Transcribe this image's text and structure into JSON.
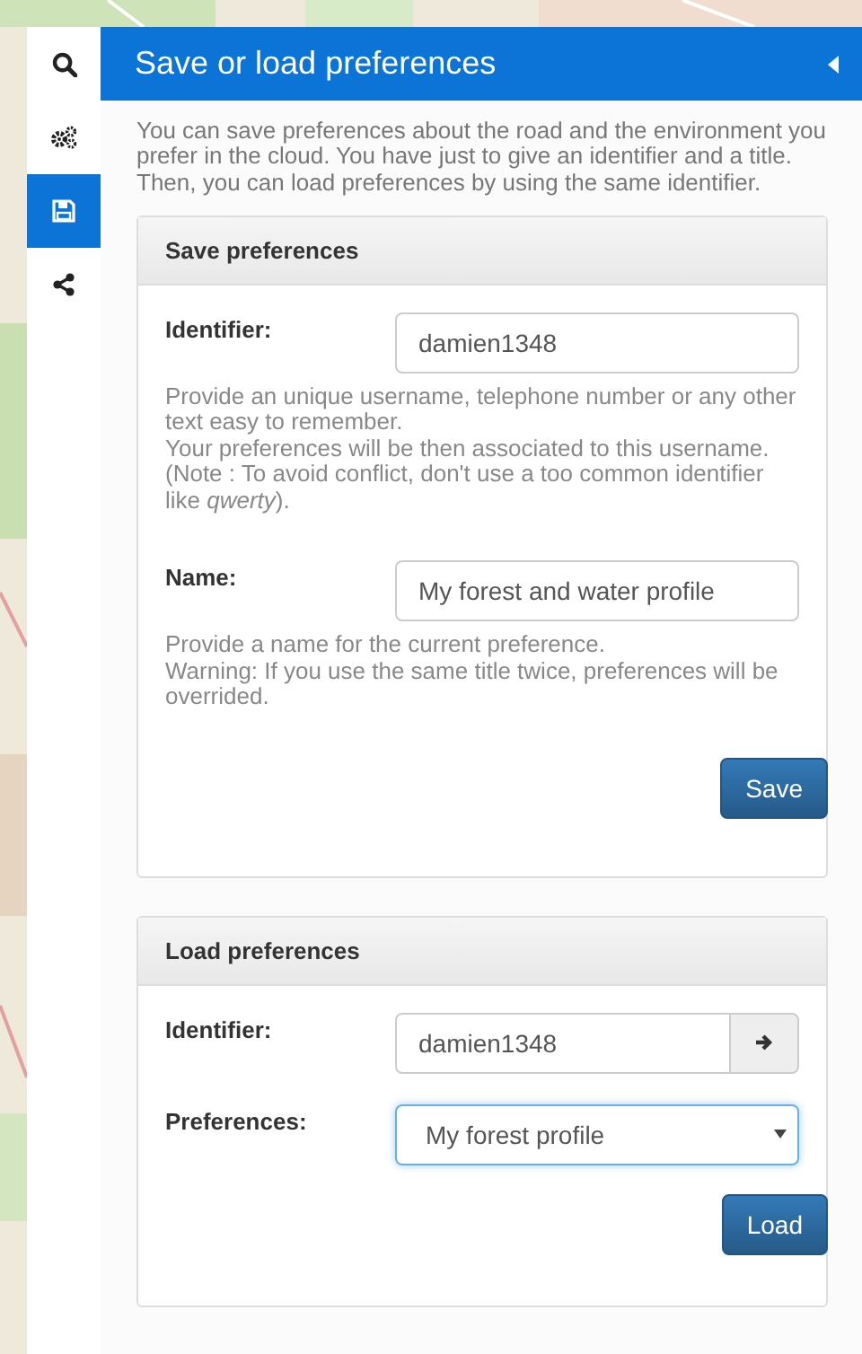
{
  "sidebar": {
    "items": [
      {
        "kind": "search",
        "selected": false
      },
      {
        "kind": "gears",
        "selected": false
      },
      {
        "kind": "save",
        "selected": true
      },
      {
        "kind": "share",
        "selected": false
      }
    ]
  },
  "panel": {
    "title": "Save or load preferences",
    "intro": "You can save preferences about the road and the environment you prefer in the cloud. You have just to give an identifier and a title. Then, you can load preferences by using the same identifier."
  },
  "save_card": {
    "title": "Save preferences",
    "fields": [
      {
        "label": "Identifier:",
        "value": "damien1348",
        "help": [
          "Provide an unique username, telephone number or any other text easy to remember.",
          "Your preferences will be then associated to this username. (Note : To avoid conflict, don't use a too common identifier like *qwerty*)."
        ]
      },
      {
        "label": "Name:",
        "value": "My forest and water profile",
        "help": [
          "Provide a name for the current preference.",
          "Warning: If you use the same title twice, preferences will be overrided."
        ]
      }
    ],
    "button": "Save"
  },
  "load_card": {
    "title": "Load preferences",
    "identifier": {
      "label": "Identifier:",
      "value": "damien1348"
    },
    "preferences": {
      "label": "Preferences:",
      "value": "My forest profile"
    },
    "button": "Load"
  }
}
